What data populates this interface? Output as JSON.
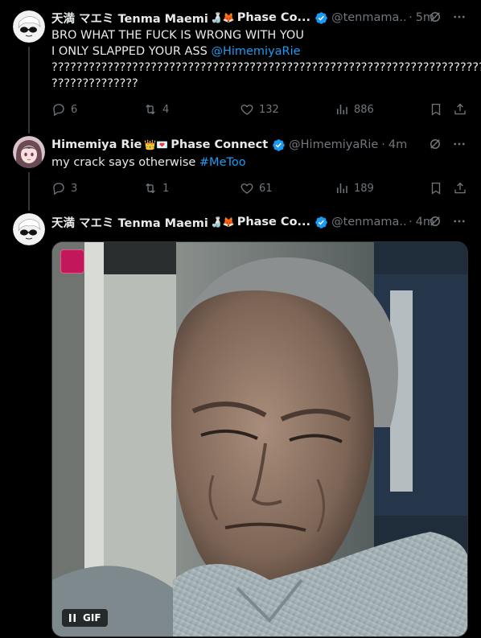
{
  "tweets": [
    {
      "display_name": "天満 マエミ Tenma Maemi",
      "badge_emoji": "🍶🦊",
      "affiliation": "Phase Co...",
      "handle": "@tenmama...",
      "time": "5m",
      "text_line1": "BRO WHAT THE FUCK IS WRONG WITH YOU",
      "text_line2_prefix": "I ONLY SLAPPED YOUR ASS ",
      "text_line2_mention": "@HimemiyaRie",
      "text_line3": "??????????????????????????????????????????????????????????????????????",
      "text_line4": "??????????????",
      "replies": "6",
      "reposts": "4",
      "likes": "132",
      "views": "886"
    },
    {
      "display_name": "Himemiya Rie",
      "badge_emoji": "👑💌",
      "affiliation": "Phase Connect",
      "handle": "@HimemiyaRie",
      "time": "4m",
      "text_prefix": "my crack says otherwise ",
      "hashtag": "#MeToo",
      "replies": "3",
      "reposts": "1",
      "likes": "61",
      "views": "189"
    },
    {
      "display_name": "天満 マエミ Tenma Maemi",
      "badge_emoji": "🍶🦊",
      "affiliation": "Phase Co...",
      "handle": "@tenmama...",
      "time": "4m",
      "gif_label": "GIF"
    }
  ],
  "colors": {
    "background": "#000000",
    "text": "#e7e9ea",
    "muted": "#71767b",
    "link": "#1d9bf0",
    "verified": "#1d9bf0"
  },
  "icons": [
    "reply-icon",
    "repost-icon",
    "like-icon",
    "views-icon",
    "bookmark-icon",
    "share-icon",
    "grok-icon",
    "more-icon",
    "verified-icon",
    "pause-icon"
  ]
}
